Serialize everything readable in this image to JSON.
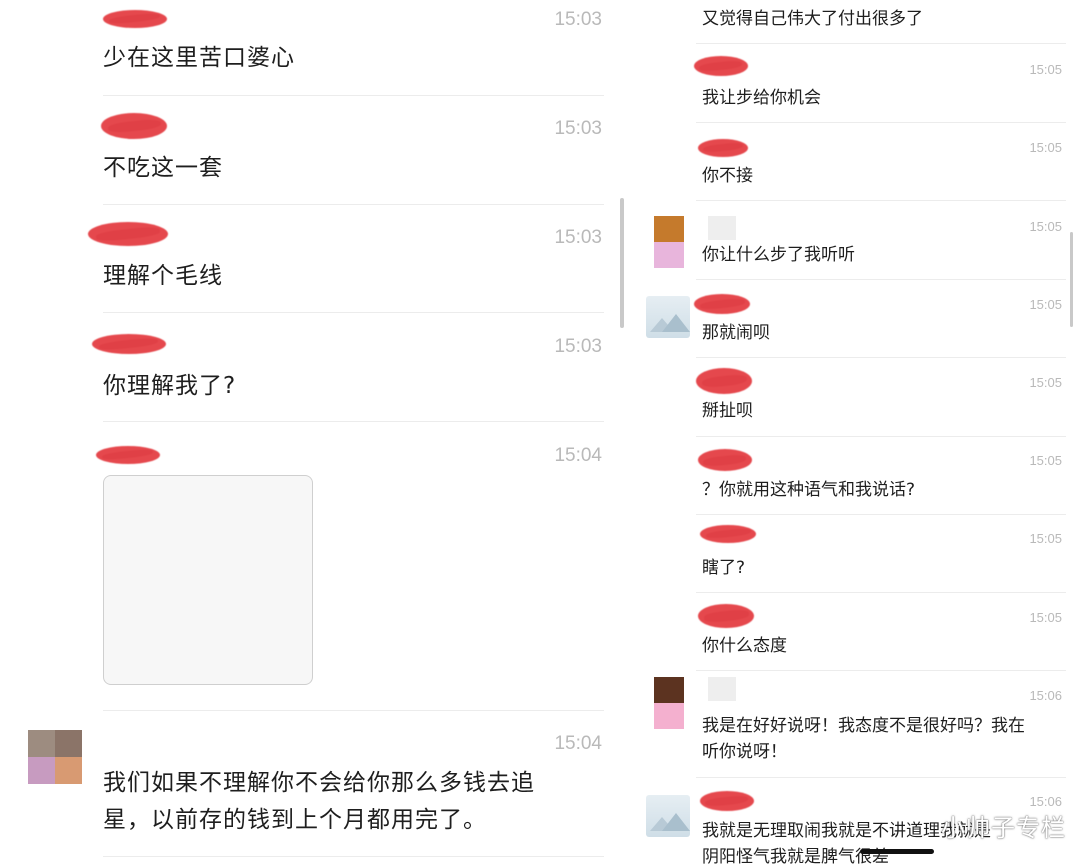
{
  "left_chat": {
    "messages": [
      {
        "time": "15:03",
        "text": "少在这里苦口婆心"
      },
      {
        "time": "15:03",
        "text": "不吃这一套"
      },
      {
        "time": "15:03",
        "text": "理解个毛线"
      },
      {
        "time": "15:03",
        "text": "你理解我了?"
      },
      {
        "time": "15:04",
        "text": ""
      },
      {
        "time": "15:04",
        "text_line1": "我们如果不理解你不会给你那么多钱去追",
        "text_line2": "星，以前存的钱到上个月都用完了。"
      }
    ],
    "avatar_colors": [
      "#9d8c80",
      "#8b7468",
      "#c79bc0",
      "#d89a72"
    ]
  },
  "right_chat": {
    "messages": [
      {
        "time": "",
        "text": "又觉得自己伟大了付出很多了"
      },
      {
        "time": "15:05",
        "text": "我让步给你机会"
      },
      {
        "time": "15:05",
        "text": "你不接"
      },
      {
        "time": "15:05",
        "text": "你让什么步了我听听"
      },
      {
        "time": "15:05",
        "text": "那就闹呗"
      },
      {
        "time": "15:05",
        "text": "掰扯呗"
      },
      {
        "time": "15:05",
        "text": "？你就用这种语气和我说话?"
      },
      {
        "time": "15:05",
        "text": "瞎了?"
      },
      {
        "time": "15:05",
        "text": "你什么态度"
      },
      {
        "time": "15:06",
        "text_line1": "我是在好好说呀！我态度不是很好吗？我在",
        "text_line2": "听你说呀！"
      },
      {
        "time": "15:06",
        "text_line1": "我就是无理取闹我就是不讲道理我就是",
        "text_line2": "阴阳怪气我就是脾气很差"
      }
    ],
    "avatar_a_colors": [
      "#c57a2c",
      "#e8b5dc"
    ],
    "avatar_b_colors": [
      "#5c3320",
      "#f4b0cf"
    ],
    "watermark": "小帅子专栏"
  },
  "colors": {
    "redaction": "#e5484d",
    "timestamp": "#b9b9b9",
    "separator": "#ececec"
  }
}
